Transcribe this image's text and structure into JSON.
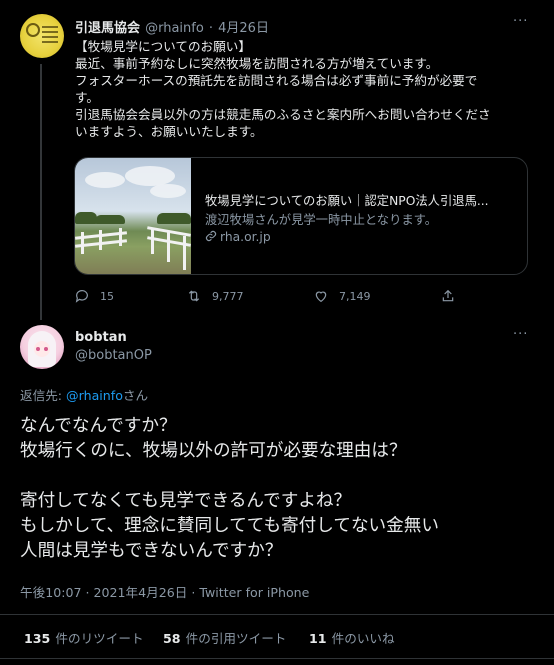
{
  "original_tweet": {
    "display_name": "引退馬協会",
    "handle": "@rhainfo",
    "separator": "·",
    "date": "4月26日",
    "menu": "···",
    "text": "【牧場見学についてのお願い】\n最近、事前予約なしに突然牧場を訪問される方が増えています。\nフォスターホースの預託先を訪問される場合は必ず事前に予約が必要で\nす。\n引退馬協会会員以外の方は競走馬のふるさと案内所へお問い合わせくださ\nいますよう、お願いいたします。",
    "card": {
      "title": "牧場見学についてのお願い｜認定NPO法人引退馬...",
      "description": "渡辺牧場さんが見学一時中止となります。",
      "link": "rha.or.jp"
    },
    "actions": {
      "replies": "15",
      "retweets": "9,777",
      "likes": "7,149"
    }
  },
  "reply_tweet": {
    "display_name": "bobtan",
    "handle": "@bobtanOP",
    "menu": "···",
    "replying_to_prefix": "返信先: ",
    "replying_to_handle": "@rhainfo",
    "replying_to_suffix": "さん",
    "text": "なんでなんですか？\n牧場行くのに、牧場以外の許可が必要な理由は？\n\n寄付してなくても見学できるんですよね？\nもしかして、理念に賛同してても寄付してない金無い\n人間は見学もできないんですか？",
    "timestamp": "午後10:07 · 2021年4月26日 · Twitter for iPhone",
    "stats": [
      {
        "count": "135",
        "label": "件のリツイート"
      },
      {
        "count": "58",
        "label": "件の引用ツイート"
      },
      {
        "count": "11",
        "label": "件のいいね"
      }
    ]
  },
  "colors": {
    "background": "#000000",
    "primary_text": "#e7e9ea",
    "secondary_text": "#8b98a5",
    "link": "#1d9bf0",
    "border": "#2f3336"
  }
}
